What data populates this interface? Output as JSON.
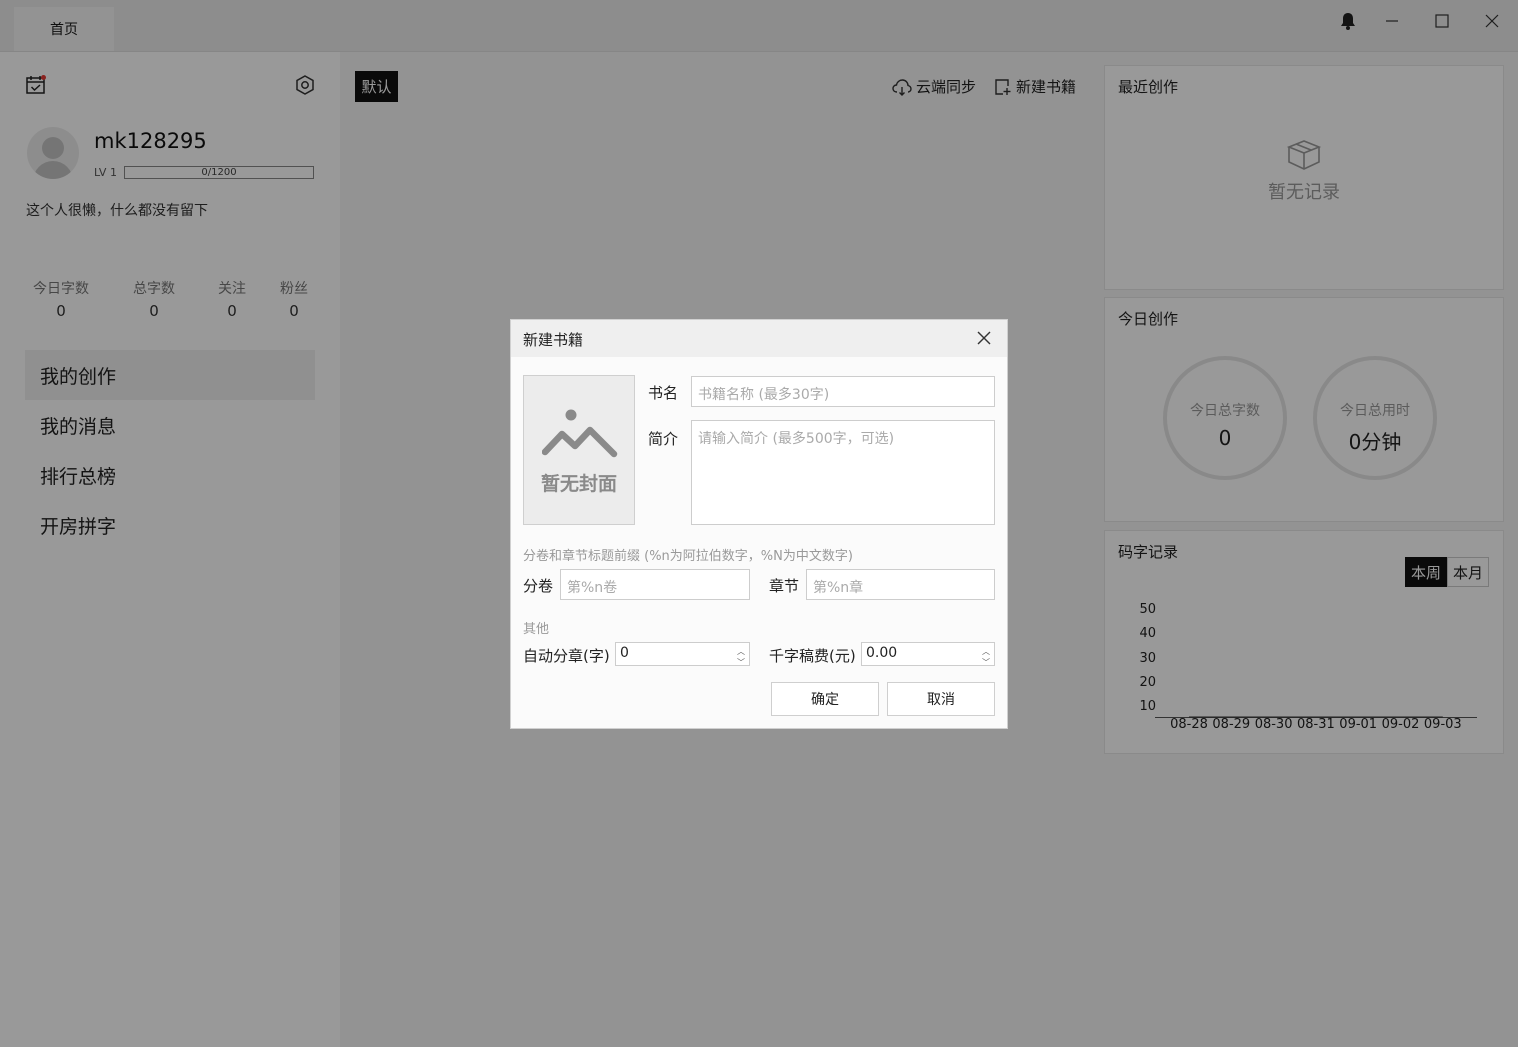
{
  "titlebar": {
    "tab_label": "首页",
    "icons": [
      "bell-icon",
      "minimize-icon",
      "maximize-icon",
      "close-icon"
    ]
  },
  "sidebar": {
    "username": "mk128295",
    "level": "LV 1",
    "exp_text": "0/1200",
    "exp_progress": 0,
    "bio": "这个人很懒，什么都没有留下",
    "stats": [
      {
        "label": "今日字数",
        "value": "0"
      },
      {
        "label": "总字数",
        "value": "0"
      },
      {
        "label": "关注",
        "value": "0"
      },
      {
        "label": "粉丝",
        "value": "0"
      }
    ],
    "menu": [
      {
        "label": "我的创作",
        "active": true
      },
      {
        "label": "我的消息",
        "active": false
      },
      {
        "label": "排行总榜",
        "active": false
      },
      {
        "label": "开房拼字",
        "active": false
      }
    ]
  },
  "main": {
    "default_tag": "默认",
    "cloud_sync_label": "云端同步",
    "new_book_label": "新建书籍"
  },
  "right": {
    "recent_title": "最近创作",
    "recent_empty": "暂无记录",
    "today_title": "今日创作",
    "today_total_label": "今日总字数",
    "today_total_value": "0",
    "today_time_label": "今日总用时",
    "today_time_value": "0分钟",
    "record_title": "码字记录",
    "seg_week": "本周",
    "seg_month": "本月",
    "chart_data": {
      "type": "line",
      "categories": [
        "08-28",
        "08-29",
        "08-30",
        "08-31",
        "09-01",
        "09-02",
        "09-03"
      ],
      "yticks": [
        "50",
        "40",
        "30",
        "20",
        "10"
      ],
      "series": [
        {
          "values": [
            0,
            0,
            0,
            0,
            0,
            0,
            0
          ]
        }
      ]
    }
  },
  "dialog": {
    "title": "新建书籍",
    "cover_text": "暂无封面",
    "name_label": "书名",
    "name_placeholder": "书籍名称 (最多30字)",
    "intro_label": "简介",
    "intro_placeholder": "请输入简介 (最多500字，可选)",
    "prefix_hint": "分卷和章节标题前缀 (%n为阿拉伯数字，%N为中文数字)",
    "volume_label": "分卷",
    "volume_placeholder": "第%n卷",
    "chapter_label": "章节",
    "chapter_placeholder": "第%n章",
    "other_hint": "其他",
    "auto_split_label": "自动分章(字)",
    "auto_split_value": "0",
    "fee_label": "千字稿费(元)",
    "fee_value": "0.00",
    "confirm_label": "确定",
    "cancel_label": "取消"
  }
}
